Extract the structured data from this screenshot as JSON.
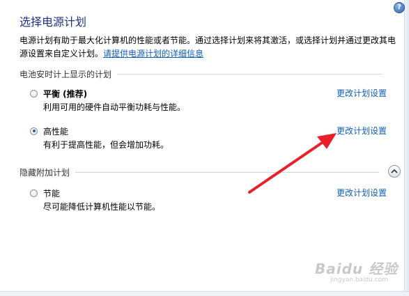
{
  "help": {
    "glyph": "?"
  },
  "title": "选择电源计划",
  "description": {
    "text": "电源计划有助于最大化计算机的性能或者节能。通过选择计划来将其激活，或选择计划并通过更改其电源设置来自定义计划。",
    "link": "请提供电源计划的详细信息"
  },
  "battery_section": {
    "label": "电池安时计上显示的计划"
  },
  "plans": [
    {
      "name": "平衡 (推荐)",
      "desc": "利用可用的硬件自动平衡功耗与性能。",
      "link": "更改计划设置",
      "checked": false
    },
    {
      "name": "高性能",
      "desc": "有利于提高性能，但会增加功耗。",
      "link": "更改计划设置",
      "checked": true
    }
  ],
  "hidden_section": {
    "label": "隐藏附加计划",
    "toggle_icon": "chevron-up-icon"
  },
  "extra_plans": [
    {
      "name": "节能",
      "desc": "尽可能降低计算机性能以节能。",
      "link": "更改计划设置",
      "checked": false
    }
  ],
  "watermark": {
    "brand": "Baidu 经验",
    "url": "jingyan.baidu.com"
  },
  "colors": {
    "title": "#1e3287",
    "link": "#0f5eb8",
    "arrow": "#e8202a"
  }
}
